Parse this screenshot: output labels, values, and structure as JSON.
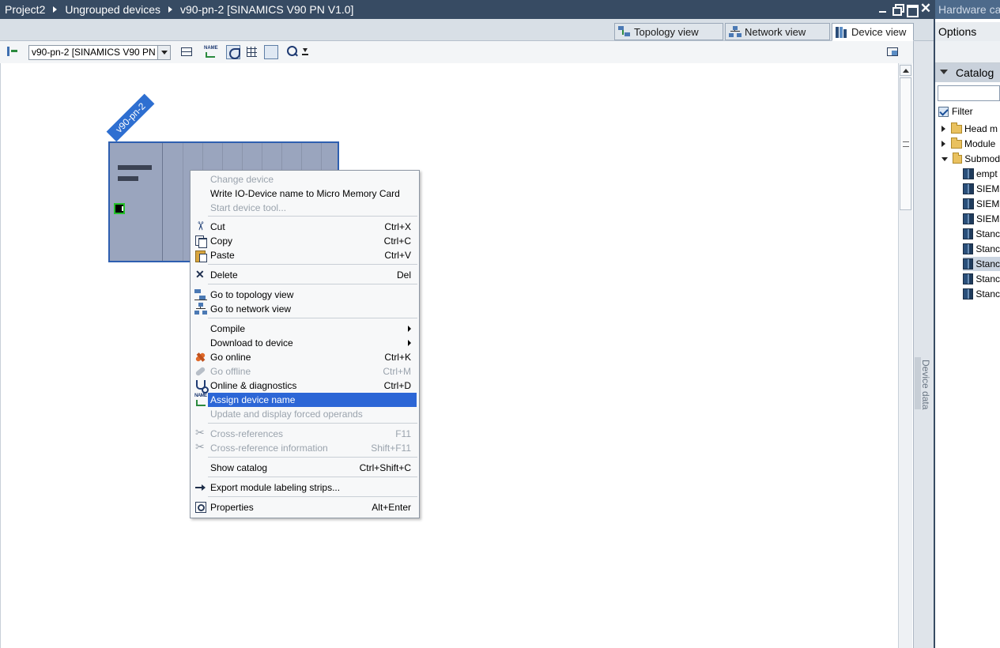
{
  "breadcrumb": [
    "Project2",
    "Ungrouped devices",
    "v90-pn-2 [SINAMICS V90 PN V1.0]"
  ],
  "window_buttons": [
    "minimize-icon",
    "float-icon",
    "maximize-icon",
    "close-icon"
  ],
  "right_panel": {
    "title": "Hardware ca",
    "options_label": "Options",
    "catalog_label": "Catalog",
    "search_value": "",
    "filter_label": "Filter",
    "filter_checked": true,
    "tree": [
      {
        "label": "Head m",
        "expanded": false,
        "kind": "folder"
      },
      {
        "label": "Module",
        "expanded": false,
        "kind": "folder"
      },
      {
        "label": "Submod",
        "expanded": true,
        "kind": "folder"
      },
      {
        "label": "empt",
        "kind": "module"
      },
      {
        "label": "SIEM",
        "kind": "module"
      },
      {
        "label": "SIEM",
        "kind": "module"
      },
      {
        "label": "SIEM",
        "kind": "module"
      },
      {
        "label": "Stanc",
        "kind": "module"
      },
      {
        "label": "Stanc",
        "kind": "module"
      },
      {
        "label": "Stanc",
        "kind": "module",
        "selected": true
      },
      {
        "label": "Stanc",
        "kind": "module"
      },
      {
        "label": "Stanc",
        "kind": "module"
      }
    ]
  },
  "tabs": [
    {
      "label": "Topology view",
      "icon": "topology-icon",
      "active": false
    },
    {
      "label": "Network view",
      "icon": "network-icon",
      "active": false
    },
    {
      "label": "Device view",
      "icon": "device-icon",
      "active": true
    }
  ],
  "toolbar": {
    "device_select_value": "v90-pn-2 [SINAMICS V90 PN V"
  },
  "device": {
    "label": "v90-pn-2"
  },
  "side_tab_label": "Device data",
  "context_menu": {
    "items": [
      {
        "label": "Change device",
        "shortcut": "",
        "disabled": true,
        "icon": ""
      },
      {
        "label": "Write IO-Device name to Micro Memory Card",
        "shortcut": "",
        "disabled": false,
        "icon": ""
      },
      {
        "label": "Start device tool...",
        "shortcut": "",
        "disabled": true,
        "icon": ""
      },
      {
        "label": "Cut",
        "shortcut": "Ctrl+X",
        "disabled": false,
        "icon": "cut-icon"
      },
      {
        "label": "Copy",
        "shortcut": "Ctrl+C",
        "disabled": false,
        "icon": "copy-icon"
      },
      {
        "label": "Paste",
        "shortcut": "Ctrl+V",
        "disabled": false,
        "icon": "paste-icon"
      },
      {
        "label": "Delete",
        "shortcut": "Del",
        "disabled": false,
        "icon": "delete-icon"
      },
      {
        "label": "Go to topology view",
        "shortcut": "",
        "disabled": false,
        "icon": "topology-icon"
      },
      {
        "label": "Go to network view",
        "shortcut": "",
        "disabled": false,
        "icon": "network-icon"
      },
      {
        "label": "Compile",
        "shortcut": "",
        "disabled": false,
        "icon": "",
        "submenu": true
      },
      {
        "label": "Download to device",
        "shortcut": "",
        "disabled": false,
        "icon": "",
        "submenu": true
      },
      {
        "label": "Go online",
        "shortcut": "Ctrl+K",
        "disabled": false,
        "icon": "go-online-icon"
      },
      {
        "label": "Go offline",
        "shortcut": "Ctrl+M",
        "disabled": true,
        "icon": "go-offline-icon"
      },
      {
        "label": "Online & diagnostics",
        "shortcut": "Ctrl+D",
        "disabled": false,
        "icon": "diagnostics-icon"
      },
      {
        "label": "Assign device name",
        "shortcut": "",
        "disabled": false,
        "icon": "assign-name-icon",
        "highlighted": true
      },
      {
        "label": "Update and display forced operands",
        "shortcut": "",
        "disabled": true,
        "icon": ""
      },
      {
        "label": "Cross-references",
        "shortcut": "F11",
        "disabled": true,
        "icon": "cross-reference-icon"
      },
      {
        "label": "Cross-reference information",
        "shortcut": "Shift+F11",
        "disabled": true,
        "icon": "cross-reference-icon"
      },
      {
        "label": "Show catalog",
        "shortcut": "Ctrl+Shift+C",
        "disabled": false,
        "icon": ""
      },
      {
        "label": "Export module labeling strips...",
        "shortcut": "",
        "disabled": false,
        "icon": "export-icon"
      },
      {
        "label": "Properties",
        "shortcut": "Alt+Enter",
        "disabled": false,
        "icon": "properties-icon"
      }
    ]
  }
}
